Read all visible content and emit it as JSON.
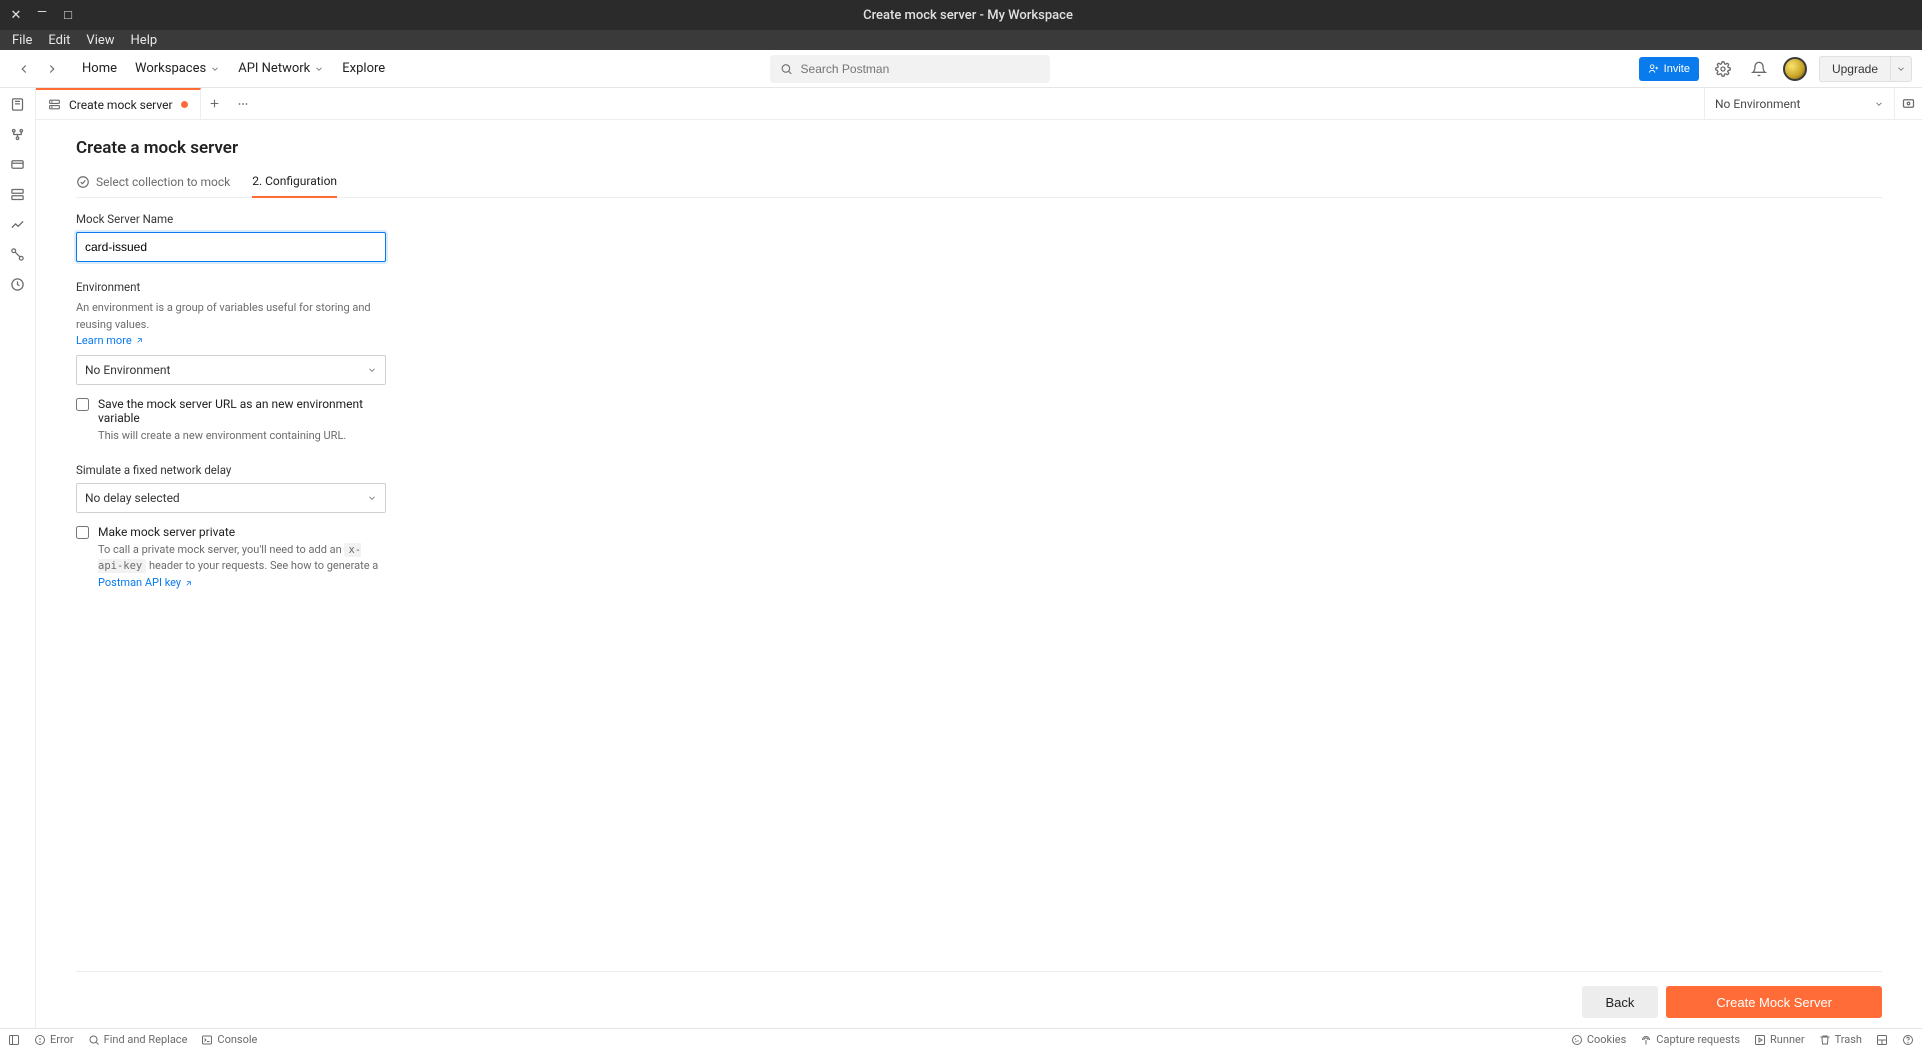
{
  "window": {
    "title": "Create mock server - My Workspace"
  },
  "menubar": [
    "File",
    "Edit",
    "View",
    "Help"
  ],
  "navbar": {
    "items": [
      {
        "label": "Home",
        "dropdown": false
      },
      {
        "label": "Workspaces",
        "dropdown": true
      },
      {
        "label": "API Network",
        "dropdown": true
      },
      {
        "label": "Explore",
        "dropdown": false
      }
    ],
    "search_placeholder": "Search Postman",
    "invite_label": "Invite",
    "upgrade_label": "Upgrade"
  },
  "tabbar": {
    "tab_label": "Create mock server",
    "env_selector": "No Environment"
  },
  "page": {
    "title": "Create a mock server",
    "steps": {
      "step1": "Select collection to mock",
      "step2": "2. Configuration"
    },
    "form": {
      "name_label": "Mock Server Name",
      "name_value": "card-issued",
      "env_label": "Environment",
      "env_hint": "An environment is a group of variables useful for storing and reusing values.",
      "learn_more": "Learn more",
      "env_select": "No Environment",
      "save_url_label": "Save the mock server URL as an new environment variable",
      "save_url_hint": "This will create a new environment containing URL.",
      "delay_label": "Simulate a fixed network delay",
      "delay_select": "No delay selected",
      "private_label": "Make mock server private",
      "private_hint_pre": "To call a private mock server, you'll need to add an ",
      "private_hint_code": "x-api-key",
      "private_hint_mid": " header to your requests. See how to generate a ",
      "private_hint_link": "Postman API key"
    },
    "footer": {
      "back": "Back",
      "create": "Create Mock Server"
    }
  },
  "statusbar": {
    "left": [
      {
        "icon": "panel",
        "label": ""
      },
      {
        "icon": "info",
        "label": "Error"
      },
      {
        "icon": "search",
        "label": "Find and Replace"
      },
      {
        "icon": "console",
        "label": "Console"
      }
    ],
    "right": [
      {
        "icon": "cookie",
        "label": "Cookies"
      },
      {
        "icon": "antenna",
        "label": "Capture requests"
      },
      {
        "icon": "play",
        "label": "Runner"
      },
      {
        "icon": "trash",
        "label": "Trash"
      },
      {
        "icon": "layout",
        "label": ""
      },
      {
        "icon": "help",
        "label": ""
      }
    ]
  }
}
